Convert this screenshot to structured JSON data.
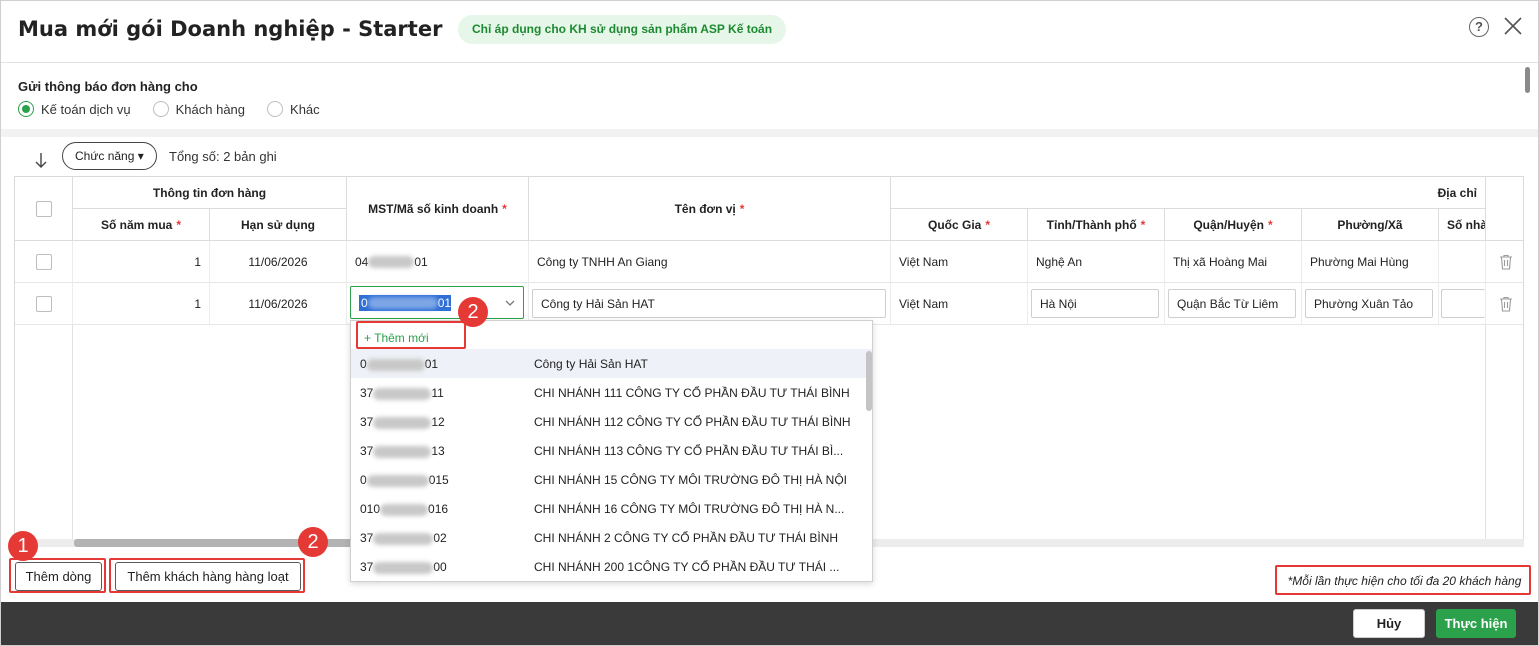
{
  "header": {
    "title": "Mua mới gói Doanh nghiệp - Starter",
    "notice_pill": "Chỉ áp dụng cho KH sử dụng sản phẩm ASP Kế toán",
    "help_icon": "?"
  },
  "notify": {
    "label": "Gửi thông báo đơn hàng cho",
    "options": [
      {
        "label": "Kế toán dịch vụ",
        "selected": true
      },
      {
        "label": "Khách hàng",
        "selected": false
      },
      {
        "label": "Khác",
        "selected": false
      }
    ]
  },
  "toolbar": {
    "function_button": "Chức năng ▾",
    "total_text": "Tổng số: 2 bản ghi"
  },
  "table": {
    "group_order_info": "Thông tin đơn hàng",
    "group_address": "Địa chỉ",
    "columns": {
      "years": "Số năm mua",
      "expiry": "Hạn sử dụng",
      "tax_code": "MST/Mã số kinh doanh",
      "unit_name": "Tên đơn vị",
      "country": "Quốc Gia",
      "province": "Tỉnh/Thành phố",
      "district": "Quận/Huyện",
      "ward": "Phường/Xã",
      "house_no": "Số nhà"
    },
    "rows": [
      {
        "years": "1",
        "expiry": "11/06/2026",
        "tax_code_prefix": "04",
        "tax_code_suffix": "01",
        "unit_name": "Công ty TNHH An Giang",
        "country": "Việt Nam",
        "province": "Nghệ An",
        "district": "Thị xã Hoàng Mai",
        "ward": "Phường Mai Hùng"
      },
      {
        "years": "1",
        "expiry": "11/06/2026",
        "tax_code_prefix": "0",
        "tax_code_suffix": "01",
        "unit_name": "Công ty Hải Sản HAT",
        "country": "Việt Nam",
        "province": "Hà Nội",
        "district": "Quận Bắc Từ Liêm",
        "ward": "Phường Xuân Tảo"
      }
    ]
  },
  "dropdown": {
    "add_new": "+ Thêm mới",
    "items": [
      {
        "code_prefix": "0",
        "code_suffix": "01",
        "name": "Công ty Hải Sản HAT",
        "selected": true
      },
      {
        "code_prefix": "37",
        "code_suffix": "11",
        "name": "CHI NHÁNH 111 CÔNG TY CỔ PHẦN ĐẦU TƯ THÁI BÌNH",
        "selected": false
      },
      {
        "code_prefix": "37",
        "code_suffix": "12",
        "name": "CHI NHÁNH 112 CÔNG TY CỔ PHẦN ĐẦU TƯ THÁI BÌNH",
        "selected": false
      },
      {
        "code_prefix": "37",
        "code_suffix": "13",
        "name": "CHI NHÁNH 113 CÔNG TY CỔ PHẦN ĐẦU TƯ THÁI BÌ...",
        "selected": false
      },
      {
        "code_prefix": "0",
        "code_suffix": "015",
        "name": "CHI NHÁNH 15 CÔNG TY MÔI TRƯỜNG ĐÔ THỊ HÀ NỘI",
        "selected": false
      },
      {
        "code_prefix": "010",
        "code_suffix": "016",
        "name": "CHI NHÁNH 16 CÔNG TY MÔI TRƯỜNG ĐÔ THỊ HÀ N...",
        "selected": false
      },
      {
        "code_prefix": "37",
        "code_suffix": "02",
        "name": "CHI NHÁNH 2 CÔNG TY CỔ PHẦN ĐẦU TƯ THÁI BÌNH",
        "selected": false
      },
      {
        "code_prefix": "37",
        "code_suffix": "00",
        "name": "CHI NHÁNH 200 1CÔNG TY CỔ PHẦN ĐẦU TƯ THÁI ...",
        "selected": false
      }
    ]
  },
  "actions": {
    "add_row": "Thêm dòng",
    "add_bulk": "Thêm khách hàng hàng loạt",
    "note": "*Mỗi lần thực hiện cho tối đa 20 khách hàng"
  },
  "badges": {
    "one": "1",
    "two": "2"
  },
  "footer": {
    "cancel": "Hủy",
    "submit": "Thực hiện"
  },
  "colors": {
    "accent": "#2aa14a",
    "annotation": "#e53935",
    "footer": "#3a3a3a"
  }
}
